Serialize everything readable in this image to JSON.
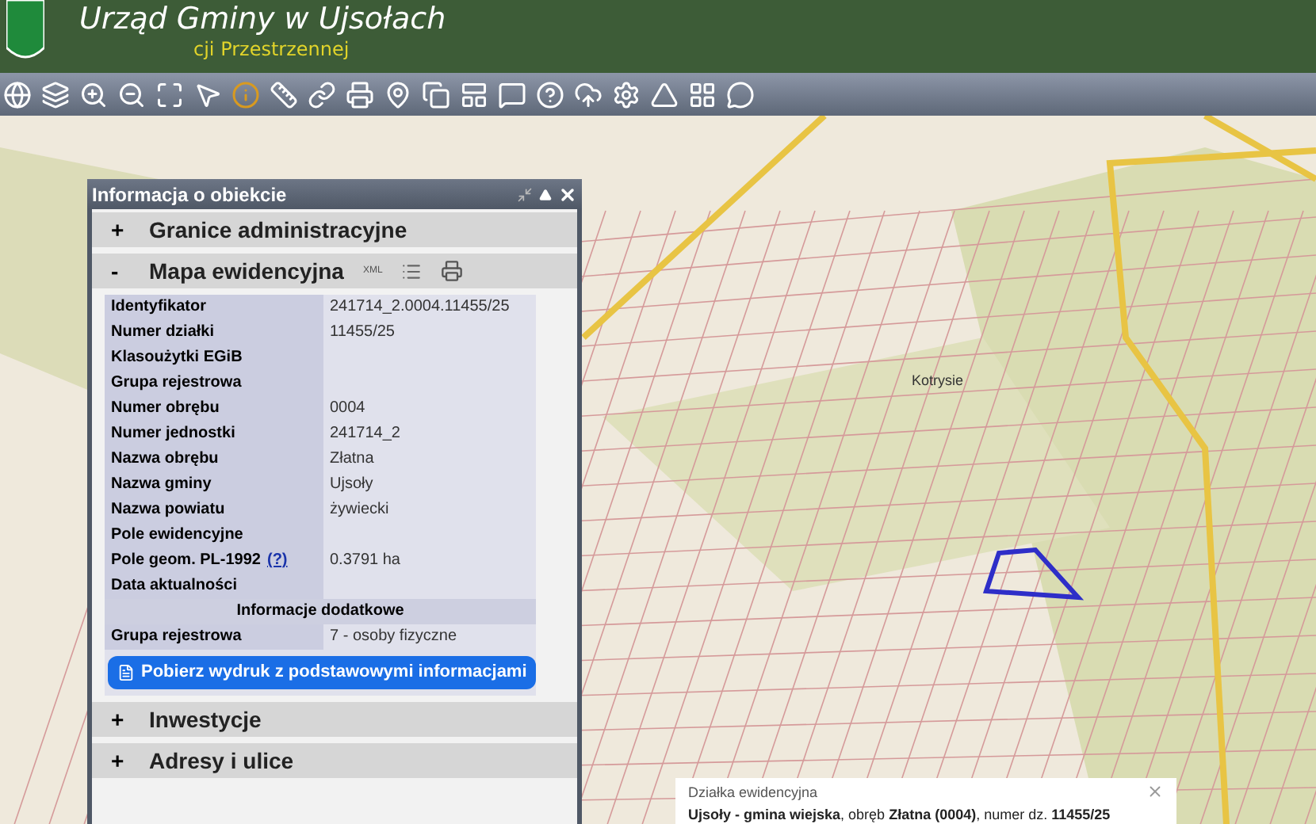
{
  "header": {
    "title": "Urząd Gminy w Ujsołach",
    "subtitle": "cji Przestrzennej"
  },
  "map": {
    "place_label": "Kotrysie"
  },
  "panel": {
    "title": "Informacja o obiekcie",
    "sections": [
      {
        "title": "Granice administracyjne",
        "marker": "+"
      },
      {
        "title": "Mapa ewidencyjna",
        "marker": "-",
        "xml": "XML",
        "rows": [
          {
            "kind": "field",
            "label": "Identyfikator",
            "value": "241714_2.0004.11455/25"
          },
          {
            "kind": "field",
            "label": "Numer działki",
            "value": "11455/25"
          },
          {
            "kind": "field",
            "label": "Klasoużytki EGiB"
          },
          {
            "kind": "field",
            "label": "Grupa rejestrowa"
          },
          {
            "kind": "field",
            "label": "Numer obrębu",
            "value": "0004"
          },
          {
            "kind": "field",
            "label": "Numer jednostki",
            "value": "241714_2"
          },
          {
            "kind": "field",
            "label": "Nazwa obrębu",
            "value": "Złatna"
          },
          {
            "kind": "field",
            "label": "Nazwa gminy",
            "value": "Ujsoły"
          },
          {
            "kind": "field",
            "label": "Nazwa powiatu",
            "value": "żywiecki"
          },
          {
            "kind": "field",
            "label": "Pole ewidencyjne"
          },
          {
            "kind": "field",
            "label": "Pole geom. PL-1992",
            "help": "(?)",
            "value": "0.3791 ha"
          },
          {
            "kind": "field",
            "label": "Data aktualności"
          },
          {
            "kind": "subheader",
            "label": "Informacje dodatkowe"
          },
          {
            "kind": "field",
            "label": "Grupa rejestrowa",
            "value": "7 - osoby fizyczne"
          }
        ],
        "button": "Pobierz wydruk z podstawowymi informacjami"
      },
      {
        "title": "Inwestycje",
        "marker": "+"
      },
      {
        "title": "Adresy i ulice",
        "marker": "+"
      }
    ]
  },
  "popup": {
    "title": "Działka ewidencyjna",
    "text": "**Ujsoły - gmina wiejska**, obręb **Złatna (0004)**, numer dz. **11455/25**"
  }
}
